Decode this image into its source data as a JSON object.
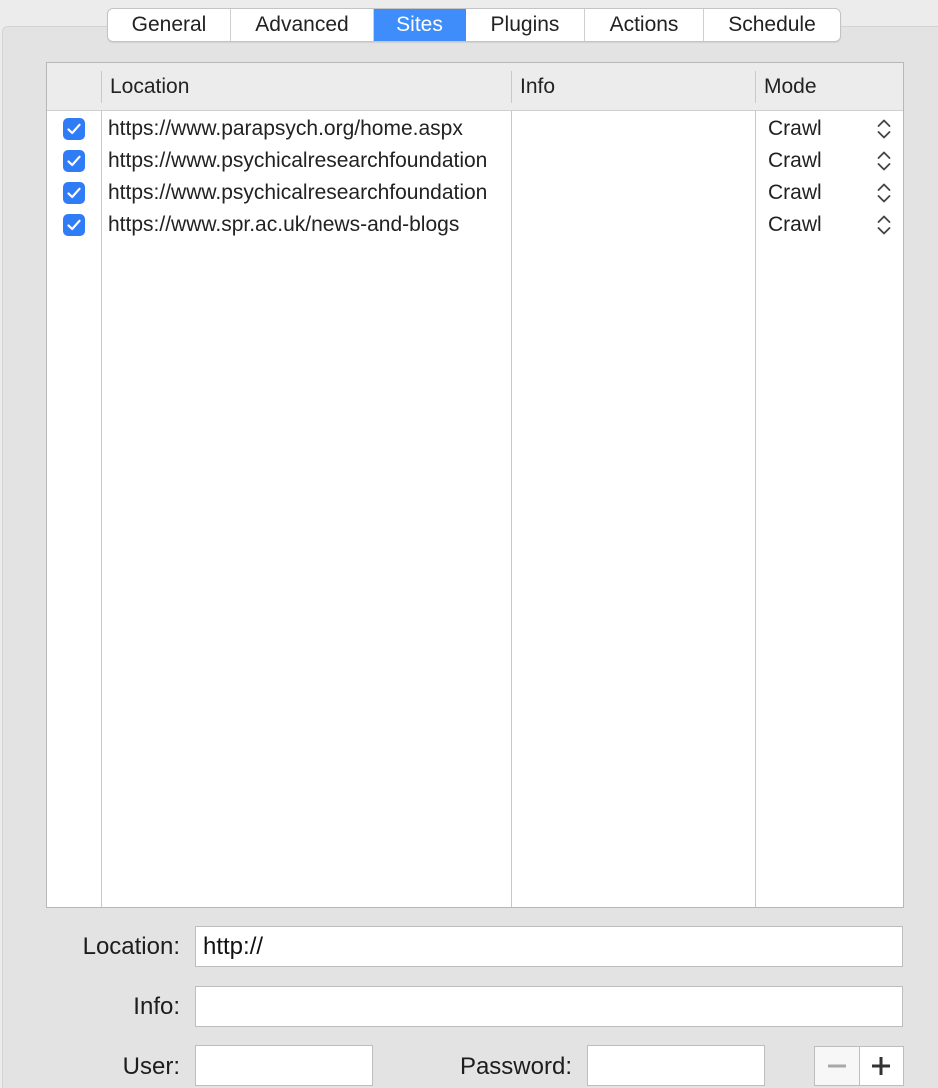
{
  "tabs": [
    {
      "label": "General",
      "active": false
    },
    {
      "label": "Advanced",
      "active": false
    },
    {
      "label": "Sites",
      "active": true
    },
    {
      "label": "Plugins",
      "active": false
    },
    {
      "label": "Actions",
      "active": false
    },
    {
      "label": "Schedule",
      "active": false
    }
  ],
  "table": {
    "headers": {
      "location": "Location",
      "info": "Info",
      "mode": "Mode"
    },
    "rows": [
      {
        "checked": true,
        "location": "https://www.parapsych.org/home.aspx",
        "info": "",
        "mode": "Crawl"
      },
      {
        "checked": true,
        "location": "https://www.psychicalresearchfoundation",
        "info": "",
        "mode": "Crawl"
      },
      {
        "checked": true,
        "location": "https://www.psychicalresearchfoundation",
        "info": "",
        "mode": "Crawl"
      },
      {
        "checked": true,
        "location": "https://www.spr.ac.uk/news-and-blogs",
        "info": "",
        "mode": "Crawl"
      }
    ]
  },
  "form": {
    "location_label": "Location:",
    "location_value": "http://",
    "info_label": "Info:",
    "info_value": "",
    "user_label": "User:",
    "user_value": "",
    "password_label": "Password:",
    "password_value": ""
  },
  "buttons": {
    "remove_icon": "minus-icon",
    "add_icon": "plus-icon"
  },
  "colors": {
    "accent": "#3f8dfb",
    "checkbox": "#2f7cf6"
  }
}
